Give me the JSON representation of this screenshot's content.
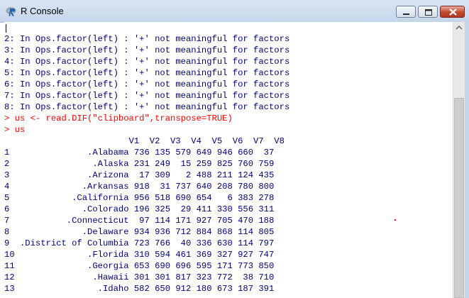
{
  "window": {
    "title": "R Console",
    "icon": "r-logo-icon"
  },
  "console": {
    "lines": [
      {
        "text": "",
        "kind": "output"
      },
      {
        "text": "2: In Ops.factor(left) : '+' not meaningful for factors",
        "kind": "output"
      },
      {
        "text": "3: In Ops.factor(left) : '+' not meaningful for factors",
        "kind": "output"
      },
      {
        "text": "4: In Ops.factor(left) : '+' not meaningful for factors",
        "kind": "output"
      },
      {
        "text": "5: In Ops.factor(left) : '+' not meaningful for factors",
        "kind": "output"
      },
      {
        "text": "6: In Ops.factor(left) : '+' not meaningful for factors",
        "kind": "output"
      },
      {
        "text": "7: In Ops.factor(left) : '+' not meaningful for factors",
        "kind": "output"
      },
      {
        "text": "8: In Ops.factor(left) : '+' not meaningful for factors",
        "kind": "output"
      },
      {
        "text": "> us <- read.DIF(\"clipboard\",transpose=TRUE)",
        "kind": "input"
      },
      {
        "text": "> us",
        "kind": "input"
      },
      {
        "text": "                        V1  V2  V3  V4  V5  V6  V7  V8",
        "kind": "output"
      },
      {
        "text": "1               .Alabama 736 135 579 649 946 660  37",
        "kind": "output"
      },
      {
        "text": "2                .Alaska 231 249  15 259 825 760 759",
        "kind": "output"
      },
      {
        "text": "3               .Arizona  17 309   2 488 211 124 435",
        "kind": "output"
      },
      {
        "text": "4              .Arkansas 918  31 737 640 208 780 800",
        "kind": "output"
      },
      {
        "text": "5            .California 956 518 690 654   6 383 278",
        "kind": "output"
      },
      {
        "text": "6              .Colorado 196 325  29 411 330 556 311",
        "kind": "output"
      },
      {
        "text": "7           .Connecticut  97 114 171 927 705 470 188",
        "kind": "output"
      },
      {
        "text": "8              .Delaware 934 936 712 884 868 114 805",
        "kind": "output"
      },
      {
        "text": "9  .District of Columbia 723 766  40 336 630 114 797",
        "kind": "output"
      },
      {
        "text": "10              .Florida 310 594 461 369 327 927 747",
        "kind": "output"
      },
      {
        "text": "11              .Georgia 653 690 696 595 171 773 850",
        "kind": "output"
      },
      {
        "text": "12               .Hawaii 301 301 817 323 772  38 710",
        "kind": "output"
      },
      {
        "text": "13                .Idaho 582 650 912 180 673 187 391",
        "kind": "output"
      }
    ]
  },
  "colors": {
    "output": "#000080",
    "input": "#ff0000"
  }
}
